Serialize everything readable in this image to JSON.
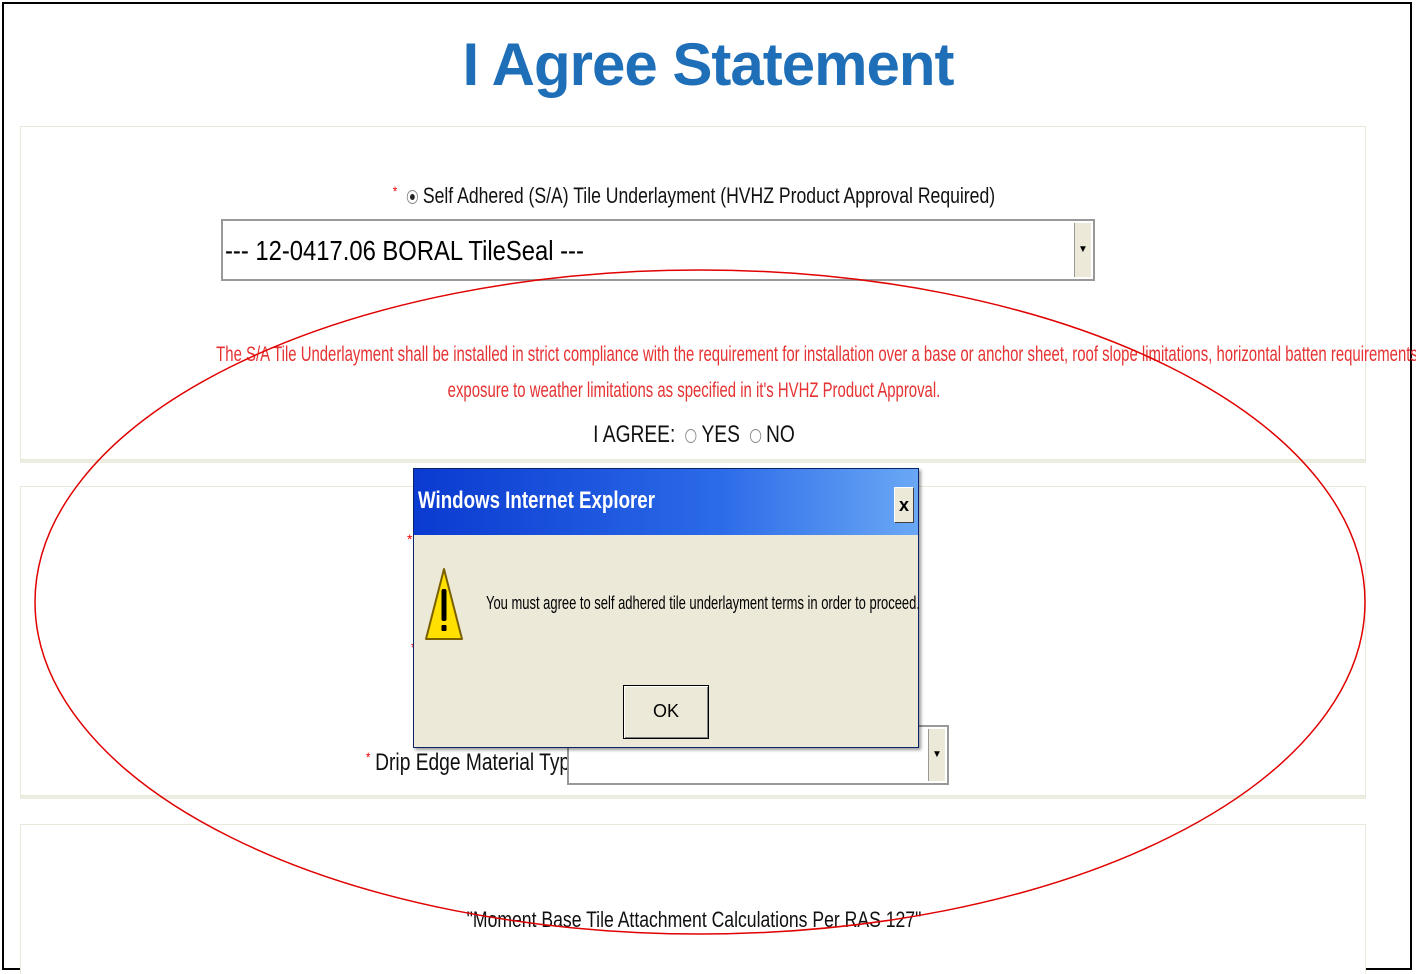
{
  "page_title": "I Agree Statement",
  "underlayment": {
    "asterisk": "*",
    "option_label": "Self Adhered (S/A) Tile Underlayment (HVHZ Product Approval Required)",
    "selected_product": "--- 12-0417.06 BORAL TileSeal ---",
    "warning_line1": "The S/A Tile Underlayment shall be installed in strict compliance with the requirement for installation over a base or anchor sheet, roof slope limitations, horizontal batten requirements, &",
    "warning_line2": "exposure to weather limitations as specified in it's HVHZ Product Approval.",
    "agree_label": "I AGREE:",
    "yes_label": "YES",
    "no_label": "NO"
  },
  "drip_edge": {
    "asterisk": "*",
    "label": "Drip Edge Material Type:"
  },
  "moment_heading": "\"Moment Base Tile Attachment Calculations Per RAS 127\"",
  "dialog": {
    "title": "Windows Internet Explorer",
    "close_label": "x",
    "message": "You must agree to self adhered tile underlayment terms in order to proceed.",
    "ok_label": "OK"
  },
  "colors": {
    "title_blue": "#1e6fb8",
    "warning_red": "#e53232",
    "annotation_red": "#e00000",
    "dialog_face": "#ece9d8"
  },
  "icons": {
    "warning": "warning-triangle-icon",
    "dropdown": "chevron-down-icon"
  }
}
